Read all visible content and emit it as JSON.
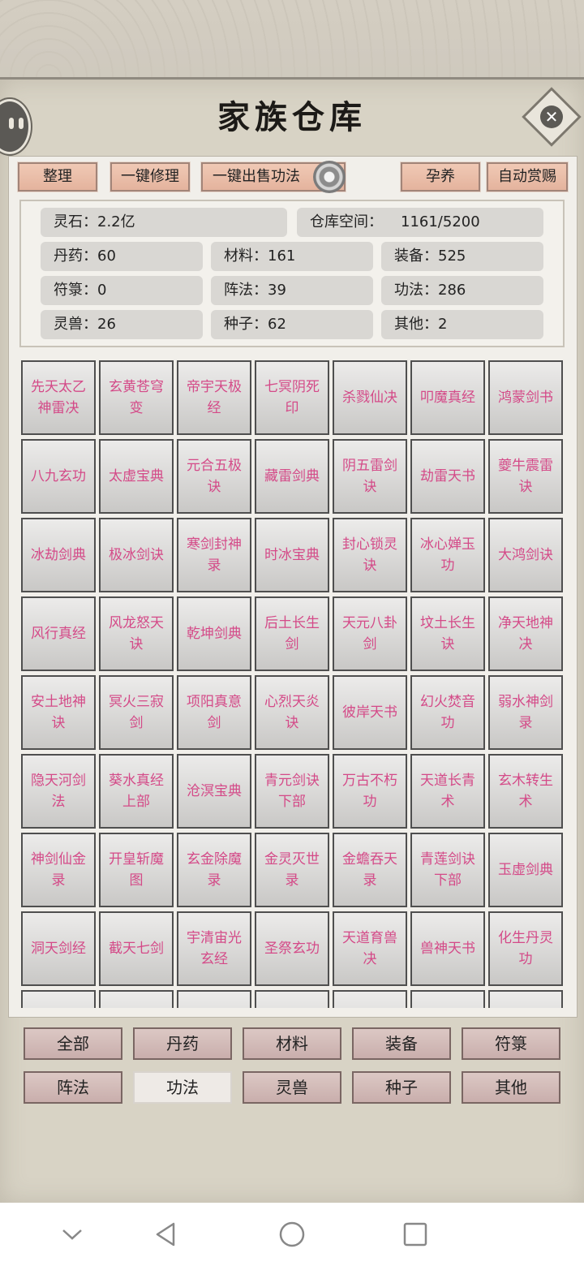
{
  "title": "家族仓库",
  "toolbar": {
    "organize": "整理",
    "repair_all": "一键修理",
    "sell_all_skills": "一键出售功法",
    "breed": "孕养",
    "auto_reward": "自动赏赐"
  },
  "stats": {
    "spirit_stone": "灵石：2.2亿",
    "storage_label": "仓库空间：",
    "storage_value": "1161/5200",
    "pills": "丹药：60",
    "materials": "材料：161",
    "equipment": "装备：525",
    "talismans": "符箓：0",
    "formations": "阵法：39",
    "skills": "功法：286",
    "beasts": "灵兽：26",
    "seeds": "种子：62",
    "others": "其他：2"
  },
  "items": [
    [
      "先天太乙",
      "神雷决"
    ],
    [
      "玄黄苍穹",
      "变"
    ],
    [
      "帝宇天极",
      "经"
    ],
    [
      "七冥阴死",
      "印"
    ],
    [
      "杀戮仙决"
    ],
    [
      "叩魔真经"
    ],
    [
      "鸿蒙剑书"
    ],
    [
      "八九玄功"
    ],
    [
      "太虚宝典"
    ],
    [
      "元合五极",
      "诀"
    ],
    [
      "藏雷剑典"
    ],
    [
      "阴五雷剑",
      "诀"
    ],
    [
      "劫雷天书"
    ],
    [
      "夔牛震雷",
      "诀"
    ],
    [
      "冰劫剑典"
    ],
    [
      "极冰剑诀"
    ],
    [
      "寒剑封神",
      "录"
    ],
    [
      "时冰宝典"
    ],
    [
      "封心锁灵",
      "诀"
    ],
    [
      "冰心婵玉",
      "功"
    ],
    [
      "大鸿剑诀"
    ],
    [
      "风行真经"
    ],
    [
      "风龙怒天",
      "诀"
    ],
    [
      "乾坤剑典"
    ],
    [
      "后土长生",
      "剑"
    ],
    [
      "天元八卦",
      "剑"
    ],
    [
      "坟土长生",
      "诀"
    ],
    [
      "净天地神",
      "决"
    ],
    [
      "安土地神",
      "诀"
    ],
    [
      "冥火三寂",
      "剑"
    ],
    [
      "项阳真意",
      "剑"
    ],
    [
      "心烈天炎",
      "诀"
    ],
    [
      "彼岸天书"
    ],
    [
      "幻火焚音",
      "功"
    ],
    [
      "弱水神剑",
      "录"
    ],
    [
      "隐天河剑",
      "法"
    ],
    [
      "葵水真经",
      "上部"
    ],
    [
      "沧溟宝典"
    ],
    [
      "青元剑诀",
      "下部"
    ],
    [
      "万古不朽",
      "功"
    ],
    [
      "天道长青",
      "术"
    ],
    [
      "玄木转生",
      "术"
    ],
    [
      "神剑仙金",
      "录"
    ],
    [
      "开皇斩魔",
      "图"
    ],
    [
      "玄金除魔",
      "录"
    ],
    [
      "金灵灭世",
      "录"
    ],
    [
      "金蟾吞天",
      "录"
    ],
    [
      "青莲剑诀",
      "下部"
    ],
    [
      "玉虚剑典"
    ],
    [
      "洞天剑经"
    ],
    [
      "截天七剑"
    ],
    [
      "宇清宙光",
      "玄经"
    ],
    [
      "圣祭玄功"
    ],
    [
      "天道育兽",
      "决"
    ],
    [
      "兽神天书"
    ],
    [
      "化生丹灵",
      "功"
    ],
    [
      ""
    ],
    [
      ""
    ],
    [
      ""
    ],
    [
      ""
    ],
    [
      ""
    ],
    [
      ""
    ],
    [
      ""
    ]
  ],
  "categories_row1": [
    "全部",
    "丹药",
    "材料",
    "装备",
    "符箓"
  ],
  "categories_row2": [
    "阵法",
    "功法",
    "灵兽",
    "种子",
    "其他"
  ],
  "active_category": "功法"
}
